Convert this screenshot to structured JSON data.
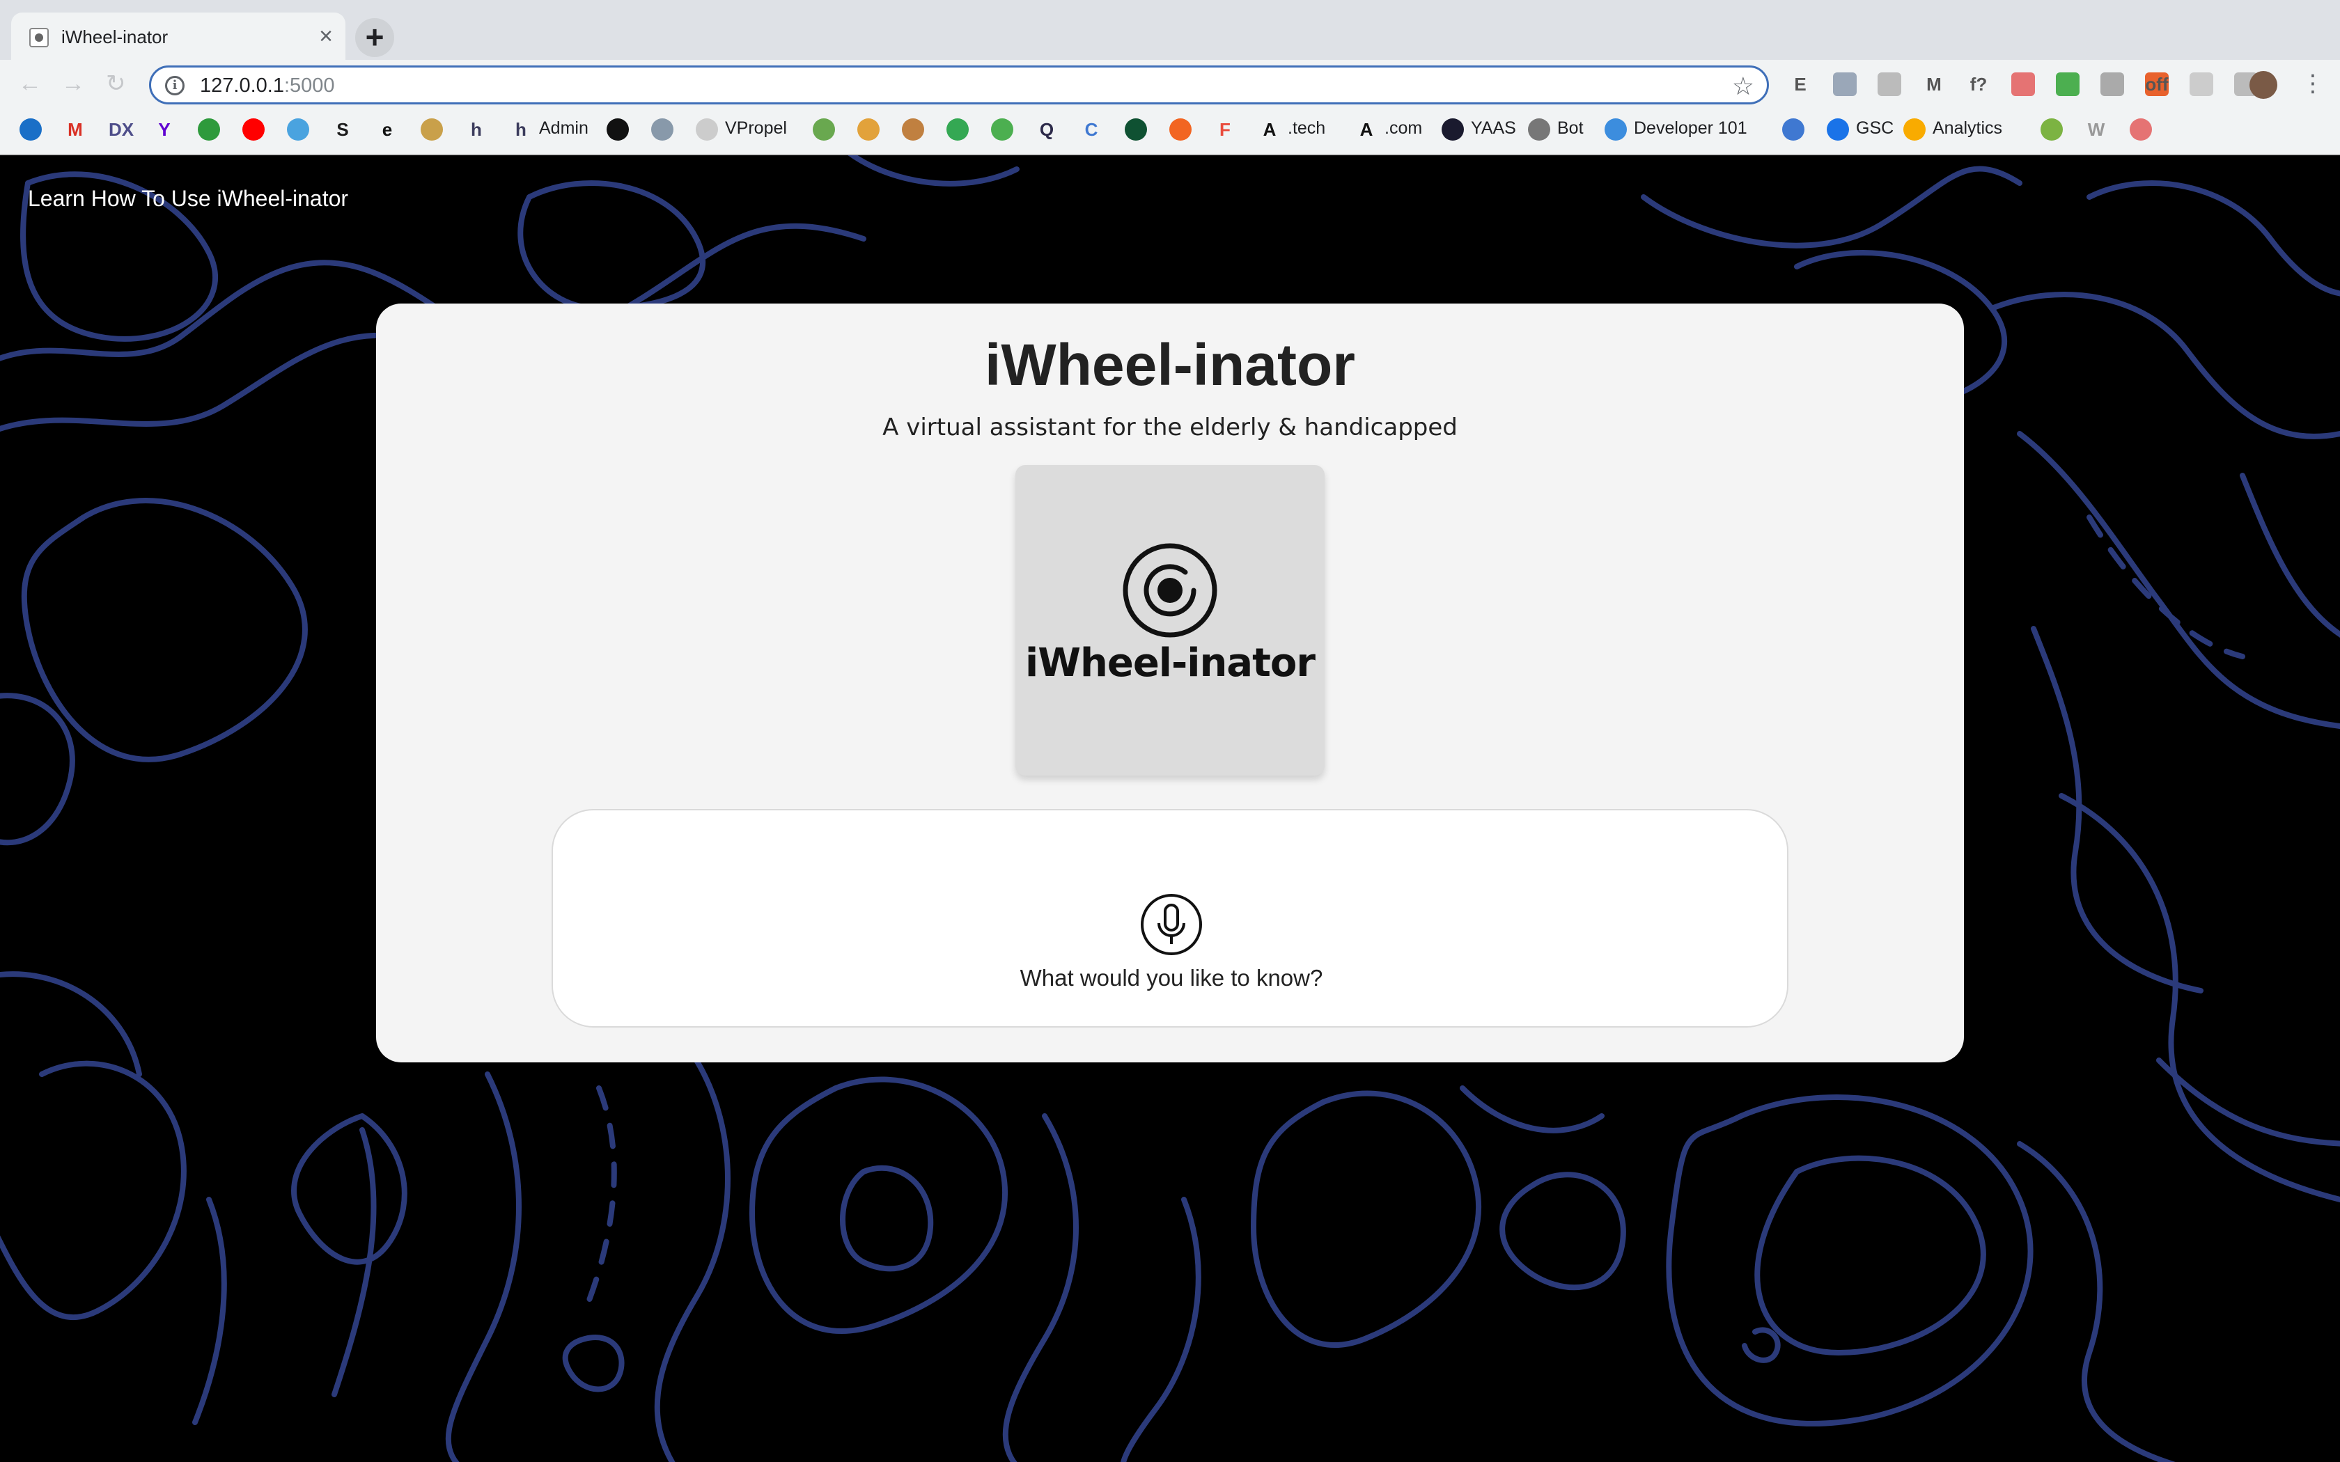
{
  "browser": {
    "tab_title": "iWheel-inator",
    "tab_close": "×",
    "new_tab": "+",
    "url_host": "127.0.0.1",
    "url_port": ":5000",
    "nav": {
      "back": "←",
      "forward": "→",
      "reload": "↻"
    },
    "star": "☆",
    "extensions": [
      "E",
      "",
      "",
      "M",
      "f?",
      "",
      "",
      "",
      "off",
      "",
      ""
    ],
    "bookmarks": [
      {
        "icon": "azure-icon",
        "color": "#1a6fc7"
      },
      {
        "icon": "gmail-icon",
        "color": "#d93025",
        "glyph": "M"
      },
      {
        "icon": "dx-icon",
        "color": "#4e4e8a",
        "glyph": "DX"
      },
      {
        "icon": "yahoo-icon",
        "color": "#5f01d1",
        "glyph": "Y"
      },
      {
        "icon": "green-1-icon",
        "color": "#2e9a3c"
      },
      {
        "icon": "youtube-icon",
        "color": "#ff0000"
      },
      {
        "icon": "bird-icon",
        "color": "#4aa3df"
      },
      {
        "icon": "s-icon",
        "color": "#1c1c1c",
        "glyph": "S"
      },
      {
        "icon": "e-icon",
        "color": "#111",
        "glyph": "e"
      },
      {
        "icon": "cards-icon",
        "color": "#c9a04a"
      },
      {
        "icon": "h-icon",
        "color": "#3b3b5c",
        "glyph": "h"
      },
      {
        "icon": "h-admin-icon",
        "color": "#3b3b5c",
        "glyph": "h",
        "label": "Admin"
      },
      {
        "icon": "github-icon",
        "color": "#111"
      },
      {
        "icon": "robot-icon",
        "color": "#8899aa"
      },
      {
        "icon": "vpropel-icon",
        "color": "#ccc",
        "label": "VPropel"
      },
      {
        "icon": "tb-icon",
        "color": "#69a84f"
      },
      {
        "icon": "pumpkin-icon",
        "color": "#e2a23b"
      },
      {
        "icon": "hand-icon",
        "color": "#c08040"
      },
      {
        "icon": "green-dot-icon",
        "color": "#34a853"
      },
      {
        "icon": "w3-icon",
        "color": "#4caf50"
      },
      {
        "icon": "q-icon",
        "color": "#2d2a4a",
        "glyph": "Q"
      },
      {
        "icon": "c-icon",
        "color": "#3f78d1",
        "glyph": "C"
      },
      {
        "icon": "v-icon",
        "color": "#0f5132"
      },
      {
        "icon": "b-icon",
        "color": "#f26522"
      },
      {
        "icon": "f-icon",
        "color": "#e94b3c",
        "glyph": "F"
      },
      {
        "icon": "a-tech-icon",
        "color": "#111",
        "glyph": "A",
        "label": ".tech"
      },
      {
        "icon": "a-com-icon",
        "color": "#111",
        "glyph": "A",
        "label": ".com"
      },
      {
        "icon": "yaas-icon",
        "color": "#1a1a2e",
        "label": "YAAS"
      },
      {
        "icon": "bot-icon",
        "color": "#777",
        "label": "Bot"
      },
      {
        "icon": "developer-icon",
        "color": "#3c8dde",
        "label": "Developer 101"
      },
      {
        "icon": "check-icon",
        "color": "#3f78d1"
      },
      {
        "icon": "gsc-icon",
        "color": "#1a73e8",
        "label": "GSC"
      },
      {
        "icon": "analytics-icon",
        "color": "#f9ab00",
        "label": "Analytics"
      },
      {
        "icon": "gear-green-icon",
        "color": "#7cb342"
      },
      {
        "icon": "w-icon",
        "color": "#999",
        "glyph": "W"
      },
      {
        "icon": "heart-icon",
        "color": "#e57373"
      }
    ]
  },
  "page": {
    "learn_link": "Learn How To Use iWheel-inator",
    "title": "iWheel-inator",
    "subtitle": "A virtual assistant for the elderly & handicapped",
    "logo_text": "iWheel-inator",
    "voice_prompt": "What would you like to know?"
  },
  "colors": {
    "background": "#000000",
    "topo_line": "#2b3a7a",
    "card": "#f4f4f4",
    "logo_box": "#dcdcdc",
    "omnibox_border": "#3f6fb8"
  }
}
